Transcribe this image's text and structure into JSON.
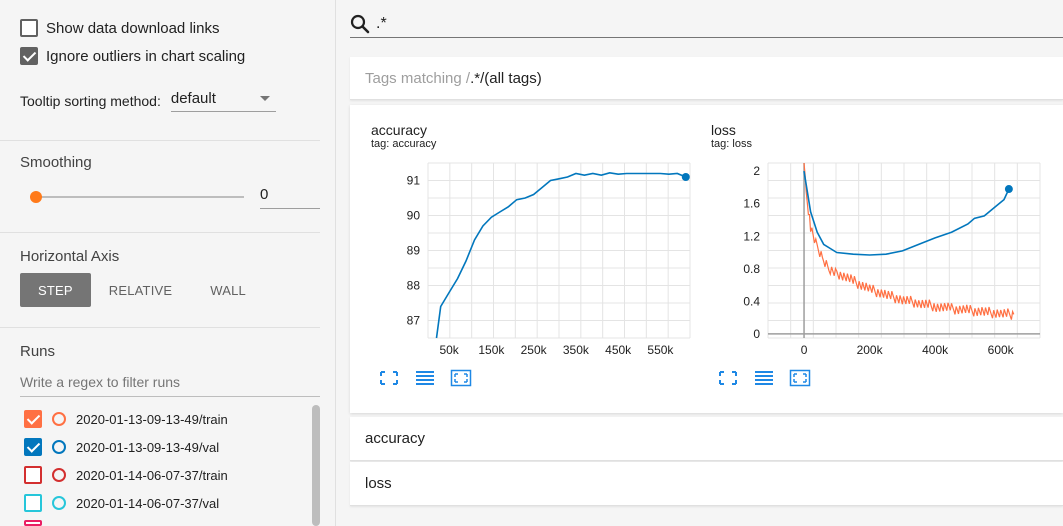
{
  "sidebar": {
    "show_download_links": {
      "label": "Show data download links",
      "checked": false
    },
    "ignore_outliers": {
      "label": "Ignore outliers in chart scaling",
      "checked": true
    },
    "tooltip_sorting": {
      "label": "Tooltip sorting method:",
      "value": "default"
    },
    "smoothing": {
      "title": "Smoothing",
      "value": "0"
    },
    "horizontal_axis": {
      "title": "Horizontal Axis",
      "options": [
        "STEP",
        "RELATIVE",
        "WALL"
      ],
      "selected": "STEP"
    },
    "runs": {
      "title": "Runs",
      "filter_placeholder": "Write a regex to filter runs",
      "items": [
        {
          "name": "2020-01-13-09-13-49/train",
          "checked": true,
          "color": "#ff7043"
        },
        {
          "name": "2020-01-13-09-13-49/val",
          "checked": true,
          "color": "#0277bd"
        },
        {
          "name": "2020-01-14-06-07-37/train",
          "checked": false,
          "color": "#d32f2f"
        },
        {
          "name": "2020-01-14-06-07-37/val",
          "checked": false,
          "color": "#26c6da"
        }
      ]
    }
  },
  "search": {
    "value": ".*",
    "icon": "search-icon"
  },
  "tags_header": {
    "prefix": "Tags matching /",
    "pattern": ".*",
    "suffix": "/(all tags)"
  },
  "charts": [
    {
      "title": "accuracy",
      "subtitle": "tag: accuracy",
      "yticks": [
        "87",
        "88",
        "89",
        "90",
        "91"
      ],
      "xticks": [
        "50k",
        "150k",
        "250k",
        "350k",
        "450k",
        "550k"
      ]
    },
    {
      "title": "loss",
      "subtitle": "tag: loss",
      "yticks": [
        "0",
        "0.4",
        "0.8",
        "1.2",
        "1.6",
        "2"
      ],
      "xticks": [
        "0",
        "200k",
        "400k",
        "600k"
      ]
    }
  ],
  "chart_data": [
    {
      "type": "line",
      "title": "accuracy",
      "subtitle": "tag: accuracy",
      "xlim": [
        0,
        620000
      ],
      "ylim": [
        86.5,
        91.5
      ],
      "series": [
        {
          "name": "2020-01-13-09-13-49/val",
          "color": "#0277bd",
          "x": [
            20000,
            30000,
            50000,
            70000,
            90000,
            110000,
            130000,
            150000,
            170000,
            190000,
            210000,
            230000,
            250000,
            270000,
            290000,
            310000,
            330000,
            350000,
            370000,
            390000,
            410000,
            430000,
            450000,
            470000,
            490000,
            510000,
            530000,
            550000,
            570000,
            590000,
            610000
          ],
          "y": [
            86.5,
            87.4,
            87.8,
            88.2,
            88.7,
            89.3,
            89.7,
            89.95,
            90.1,
            90.25,
            90.45,
            90.5,
            90.6,
            90.8,
            91.0,
            91.05,
            91.1,
            91.2,
            91.15,
            91.2,
            91.15,
            91.22,
            91.18,
            91.2,
            91.2,
            91.2,
            91.2,
            91.2,
            91.18,
            91.2,
            91.1
          ]
        }
      ]
    },
    {
      "type": "line",
      "title": "loss",
      "subtitle": "tag: loss",
      "xlim": [
        -110000,
        720000
      ],
      "ylim": [
        -0.05,
        2.1
      ],
      "series": [
        {
          "name": "2020-01-13-09-13-49/train",
          "color": "#ff7043",
          "x": [
            0,
            10000,
            20000,
            40000,
            60000,
            80000,
            100000,
            150000,
            200000,
            250000,
            300000,
            350000,
            400000,
            450000,
            500000,
            550000,
            600000,
            640000
          ],
          "y": [
            2.1,
            1.6,
            1.3,
            1.05,
            0.9,
            0.8,
            0.75,
            0.65,
            0.55,
            0.48,
            0.42,
            0.38,
            0.34,
            0.31,
            0.29,
            0.27,
            0.25,
            0.24
          ]
        },
        {
          "name": "2020-01-13-09-13-49/val",
          "color": "#0277bd",
          "x": [
            0,
            20000,
            40000,
            60000,
            80000,
            100000,
            150000,
            200000,
            250000,
            300000,
            350000,
            400000,
            450000,
            500000,
            520000,
            550000,
            580000,
            610000,
            625000
          ],
          "y": [
            2.0,
            1.5,
            1.25,
            1.1,
            1.05,
            1.0,
            0.98,
            0.97,
            0.98,
            1.02,
            1.1,
            1.18,
            1.25,
            1.35,
            1.42,
            1.45,
            1.55,
            1.65,
            1.78
          ]
        }
      ]
    }
  ],
  "categories": [
    "accuracy",
    "loss"
  ]
}
